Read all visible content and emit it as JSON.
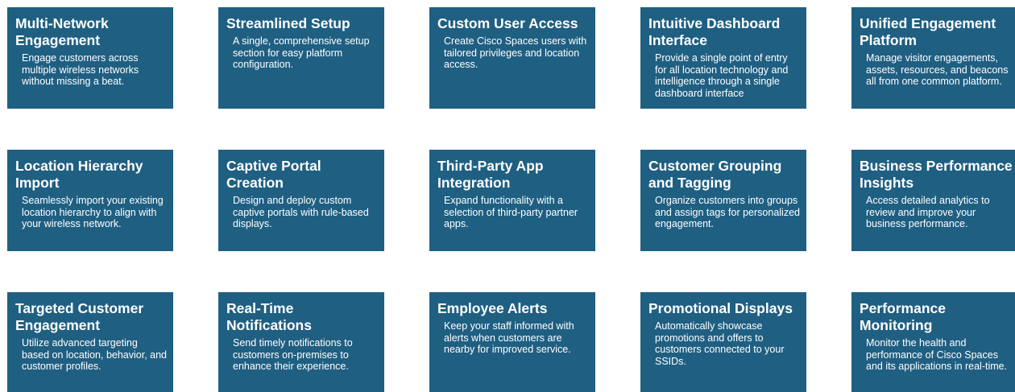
{
  "cards": [
    {
      "title": "Multi-Network Engagement",
      "desc": "Engage customers across multiple wireless networks without missing a beat."
    },
    {
      "title": "Streamlined Setup",
      "desc": "A single, comprehensive setup section for easy platform configuration."
    },
    {
      "title": "Custom User Access",
      "desc": "Create Cisco Spaces users with tailored privileges and location access."
    },
    {
      "title": "Intuitive Dashboard Interface",
      "desc": "Provide a single point of entry for all location technology and intelligence through a single dashboard interface"
    },
    {
      "title": "Unified Engagement Platform",
      "desc": "Manage visitor engagements, assets, resources, and beacons all from one common platform."
    },
    {
      "title": "Location Hierarchy Import",
      "desc": "Seamlessly import your existing location hierarchy to align with your wireless network."
    },
    {
      "title": "Captive Portal Creation",
      "desc": "Design and deploy custom captive portals with rule-based displays."
    },
    {
      "title": "Third-Party App Integration",
      "desc": "Expand functionality with a selection of third-party partner apps."
    },
    {
      "title": "Customer Grouping and Tagging",
      "desc": "Organize customers into groups and assign tags for personalized engagement."
    },
    {
      "title": "Business Performance Insights",
      "desc": "Access detailed analytics to review and improve your business performance."
    },
    {
      "title": "Targeted Customer Engagement",
      "desc": "Utilize advanced targeting based on location, behavior, and customer profiles."
    },
    {
      "title": "Real-Time Notifications",
      "desc": "Send timely notifications to customers on-premises to enhance their experience."
    },
    {
      "title": "Employee Alerts",
      "desc": "Keep your staff informed with alerts when customers are nearby for improved service."
    },
    {
      "title": "Promotional Displays",
      "desc": "Automatically showcase promotions and offers to customers connected to your SSIDs."
    },
    {
      "title": "Performance Monitoring",
      "desc": "Monitor the health and performance of Cisco Spaces and its applications in real-time."
    }
  ],
  "colors": {
    "card_background": "#1f5f82",
    "text": "#ffffff",
    "page_background": "#ffffff"
  }
}
